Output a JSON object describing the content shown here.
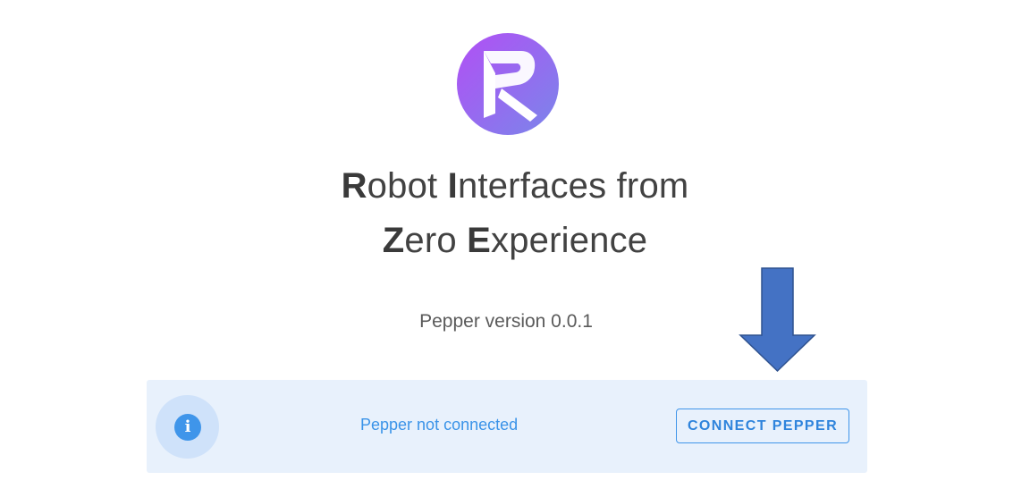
{
  "header": {
    "title_line1_parts": [
      {
        "bold": "R",
        "rest": "obot "
      },
      {
        "bold": "I",
        "rest": "nterfaces from"
      }
    ],
    "title_line2_parts": [
      {
        "bold": "Z",
        "rest": "ero "
      },
      {
        "bold": "E",
        "rest": "xperience"
      }
    ],
    "version": "Pepper version 0.0.1"
  },
  "logo": {
    "icon": "riz-logo-icon",
    "gradient_start": "#a855f7",
    "gradient_end": "#7b7fe8"
  },
  "alert": {
    "icon": "info-icon",
    "icon_glyph": "i",
    "message": "Pepper not connected",
    "button_label": "CONNECT PEPPER",
    "background_color": "#e8f1fc",
    "accent_color": "#3f95ea"
  },
  "annotation": {
    "icon": "down-arrow-icon",
    "color": "#4472c4"
  }
}
